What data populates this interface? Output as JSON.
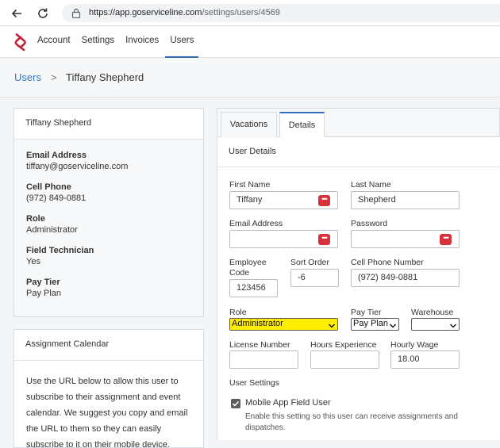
{
  "browser": {
    "url_host": "https://app.goserviceline.com",
    "url_path": "/settings/users/4569"
  },
  "nav": {
    "items": [
      "Account",
      "Settings",
      "Invoices",
      "Users"
    ],
    "active_index": 3
  },
  "breadcrumb": {
    "parent": "Users",
    "separator": ">",
    "current": "Tiffany Shepherd"
  },
  "profile": {
    "name": "Tiffany Shepherd",
    "email_label": "Email Address",
    "email": "tiffany@goserviceline.com",
    "cell_label": "Cell Phone",
    "cell": "(972) 849-0881",
    "role_label": "Role",
    "role": "Administrator",
    "tech_label": "Field Technician",
    "tech": "Yes",
    "tier_label": "Pay Tier",
    "tier": "Pay Plan"
  },
  "calendar": {
    "title": "Assignment Calendar",
    "text": "Use the URL below to allow this user to subscribe to their assignment and event calendar. We suggest you copy and email the URL to them so they can easily subscribe to it on their mobile device."
  },
  "tabs": {
    "vacations": "Vacations",
    "details": "Details",
    "active": "details"
  },
  "details": {
    "section_title": "User Details",
    "first_name_label": "First Name",
    "first_name": "Tiffany",
    "last_name_label": "Last Name",
    "last_name": "Shepherd",
    "email_label": "Email Address",
    "email": "",
    "password_label": "Password",
    "password": "",
    "employee_code_label": "Employee Code",
    "employee_code": "123456",
    "sort_order_label": "Sort Order",
    "sort_order": "-6",
    "cell_label": "Cell Phone Number",
    "cell": "(972) 849-0881",
    "role_label": "Role",
    "role": "Administrator",
    "pay_tier_label": "Pay Tier",
    "pay_tier": "Pay Plan",
    "warehouse_label": "Warehouse",
    "warehouse": "",
    "license_label": "License Number",
    "license": "",
    "hours_label": "Hours Experience",
    "hours": "",
    "wage_label": "Hourly Wage",
    "wage": "18.00",
    "settings_title": "User Settings",
    "mobile_label": "Mobile App Field User",
    "mobile_checked": true,
    "mobile_help": "Enable this setting so this user can receive assignments and dispatches."
  },
  "colors": {
    "accent": "#2f6eb5",
    "link": "#3476c0",
    "logo": "#c0223a",
    "highlight": "#ffee00",
    "password_icon": "#d9313c"
  }
}
